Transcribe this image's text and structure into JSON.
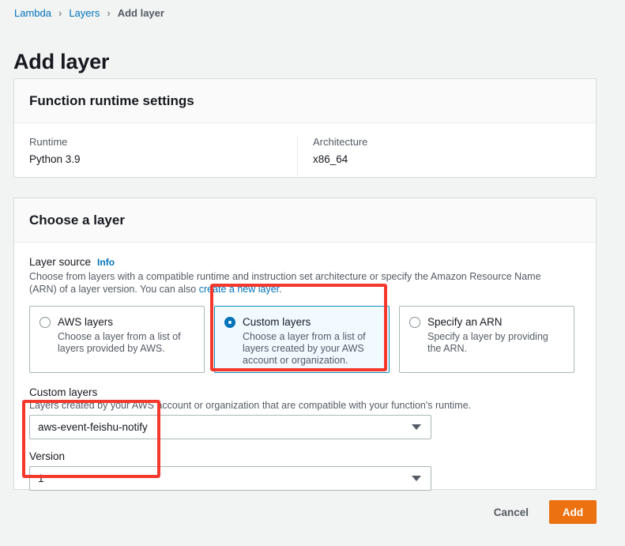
{
  "breadcrumb": {
    "items": [
      {
        "label": "Lambda",
        "current": false
      },
      {
        "label": "Layers",
        "current": false
      },
      {
        "label": "Add layer",
        "current": true
      }
    ],
    "separator": "›"
  },
  "page": {
    "title": "Add layer"
  },
  "runtime_panel": {
    "header": "Function runtime settings",
    "fields": [
      {
        "label": "Runtime",
        "value": "Python 3.9"
      },
      {
        "label": "Architecture",
        "value": "x86_64"
      }
    ]
  },
  "layer_panel": {
    "header": "Choose a layer",
    "layer_source": {
      "label": "Layer source",
      "info_link": "Info",
      "description_part1": "Choose from layers with a compatible runtime and instruction set architecture or specify the Amazon Resource Name (ARN) of a layer version. You can also ",
      "description_link": "create a new layer",
      "description_part2": "."
    },
    "options": [
      {
        "title": "AWS layers",
        "description": "Choose a layer from a list of layers provided by AWS.",
        "selected": false
      },
      {
        "title": "Custom layers",
        "description": "Choose a layer from a list of layers created by your AWS account or organization.",
        "selected": true
      },
      {
        "title": "Specify an ARN",
        "description": "Specify a layer by providing the ARN.",
        "selected": false
      }
    ],
    "custom_layers": {
      "label": "Custom layers",
      "hint": "Layers created by your AWS account or organization that are compatible with your function's runtime.",
      "selected_value": "aws-event-feishu-notify"
    },
    "version": {
      "label": "Version",
      "selected_value": "1"
    }
  },
  "footer": {
    "cancel_label": "Cancel",
    "add_label": "Add"
  },
  "colors": {
    "accent_blue": "#0073bb",
    "selected_border": "#0a8eb6",
    "selected_background": "#f1faff",
    "button_orange": "#ec7211",
    "annotation_red": "#f5382c",
    "page_background": "#f2f3f3"
  }
}
